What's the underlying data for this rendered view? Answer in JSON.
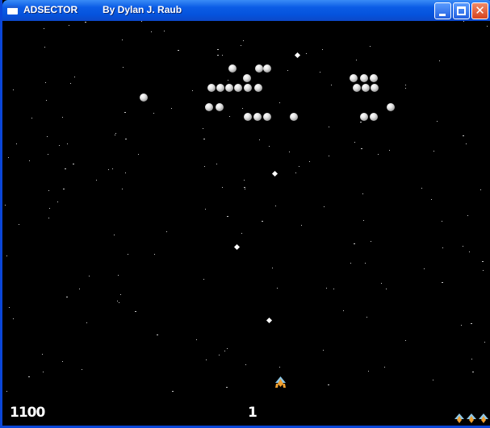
{
  "window": {
    "app_name": "ADSECTOR",
    "author": "By Dylan J. Raub",
    "buttons": [
      "minimize",
      "maximize",
      "close"
    ],
    "close_glyph": "✕"
  },
  "hud": {
    "score": "1100",
    "level": "1",
    "lives": 3
  },
  "colors": {
    "titlebar": "#0553dc",
    "background": "#000000",
    "enemy": "#d8d8d8",
    "ship_wing": "#8fc8e8",
    "ship_body": "#f0a030"
  },
  "game": {
    "enemy_count": 29,
    "enemy_bullets": 4
  }
}
